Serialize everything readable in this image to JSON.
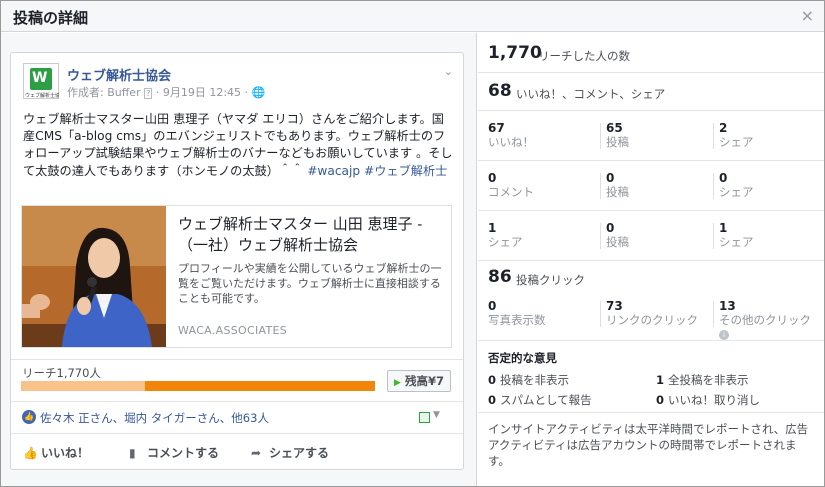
{
  "dialog": {
    "title": "投稿の詳細",
    "close_glyph": "×"
  },
  "post": {
    "page_name": "ウェブ解析士協会",
    "logo_caption": "ウェブ解析士協会",
    "meta_prefix": "作成者: Buffer",
    "meta_help": "?",
    "meta_suffix": "· 9月19日 12:45 ·",
    "globe": "🌐",
    "text_before_tags": "ウェブ解析士マスター山田 恵理子（ヤマダ エリコ）さんをご紹介します。国産CMS「a-blog cms」のエバンジェリストでもあります。ウェブ解析士のフォローアップ試験結果やウェブ解析士のバナーなどもお願いしています 。そして太鼓の達人でもあります（ホンモノの太鼓）＾＾",
    "tag1": "#wacajp",
    "tag2": "#ウェブ解析士",
    "link": {
      "title": "ウェブ解析士マスター 山田 恵理子 - （一社）ウェブ解析士協会",
      "description": "プロフィールや実績を公開しているウェブ解析士の一覧をご覧いただけます。ウェブ解析士に直接相談することも可能です。",
      "domain": "WACA.ASSOCIATES"
    },
    "reach_label": "リーチ1,770人",
    "reach_fraction": 0.65,
    "boost_label": "残高¥7",
    "likes_text": "佐々木 正さん、堀内 タイガーさん、他63人",
    "actions": {
      "like": "いいね！",
      "comment": "コメントする",
      "share": "シェアする"
    }
  },
  "insights": {
    "reach": {
      "value": "1,770",
      "label": "リーチした人の数"
    },
    "engagement": {
      "value": "68",
      "label": "いいね！、コメント、シェア"
    },
    "grid": [
      [
        {
          "num": "67",
          "lbl": "いいね！"
        },
        {
          "num": "65",
          "lbl": "投稿"
        },
        {
          "num": "2",
          "lbl": "シェア"
        }
      ],
      [
        {
          "num": "0",
          "lbl": "コメント"
        },
        {
          "num": "0",
          "lbl": "投稿"
        },
        {
          "num": "0",
          "lbl": "シェア"
        }
      ],
      [
        {
          "num": "1",
          "lbl": "シェア"
        },
        {
          "num": "0",
          "lbl": "投稿"
        },
        {
          "num": "1",
          "lbl": "シェア"
        }
      ]
    ],
    "clicks": {
      "value": "86",
      "label": "投稿クリック"
    },
    "click_breakdown": [
      {
        "num": "0",
        "lbl": "写真表示数"
      },
      {
        "num": "73",
        "lbl": "リンクのクリック"
      },
      {
        "num": "13",
        "lbl": "その他のクリック"
      }
    ],
    "negative": {
      "title": "否定的な意見",
      "items": [
        {
          "num": "0",
          "lbl": "投稿を非表示"
        },
        {
          "num": "1",
          "lbl": "全投稿を非表示"
        },
        {
          "num": "0",
          "lbl": "スパムとして報告"
        },
        {
          "num": "0",
          "lbl": "いいね！取り消し"
        }
      ]
    },
    "footnote": "インサイトアクティビティは太平洋時間でレポートされ、広告アクティビティは広告アカウントの時間帯でレポートされます。"
  }
}
